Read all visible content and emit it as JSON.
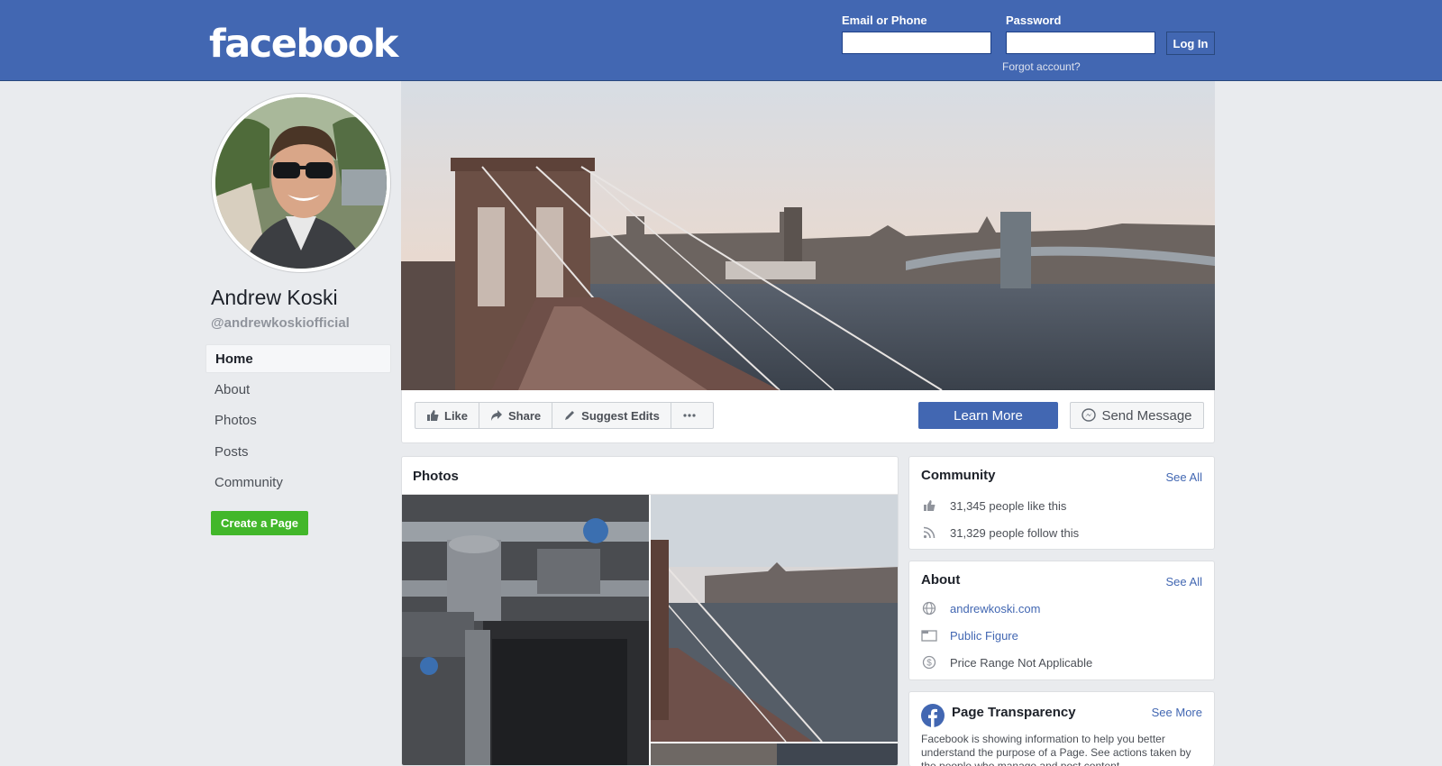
{
  "header": {
    "logo": "facebook",
    "email_label": "Email or Phone",
    "email_value": "",
    "password_label": "Password",
    "password_value": "",
    "login_button": "Log In",
    "forgot_link": "Forgot account?",
    "brand_color": "#4267b2"
  },
  "profile": {
    "name": "Andrew Koski",
    "handle": "@andrewkoskiofficial"
  },
  "nav": {
    "items": [
      {
        "label": "Home",
        "active": true
      },
      {
        "label": "About"
      },
      {
        "label": "Photos"
      },
      {
        "label": "Posts"
      },
      {
        "label": "Community"
      }
    ],
    "create_page_button": "Create a Page"
  },
  "actions": {
    "like": "Like",
    "share": "Share",
    "suggest_edits": "Suggest Edits",
    "more_icon": "ellipsis-icon",
    "learn_more": "Learn More",
    "send_message": "Send Message"
  },
  "photos": {
    "title": "Photos"
  },
  "community": {
    "title": "Community",
    "see_all": "See All",
    "likes": "31,345 people like this",
    "follows": "31,329 people follow this"
  },
  "about": {
    "title": "About",
    "see_all": "See All",
    "website": "andrewkoski.com",
    "category": "Public Figure",
    "price_range": "Price Range Not Applicable"
  },
  "transparency": {
    "title": "Page Transparency",
    "see_more": "See More",
    "text": "Facebook is showing information to help you better understand the purpose of a Page. See actions taken by the people who manage and post content."
  }
}
